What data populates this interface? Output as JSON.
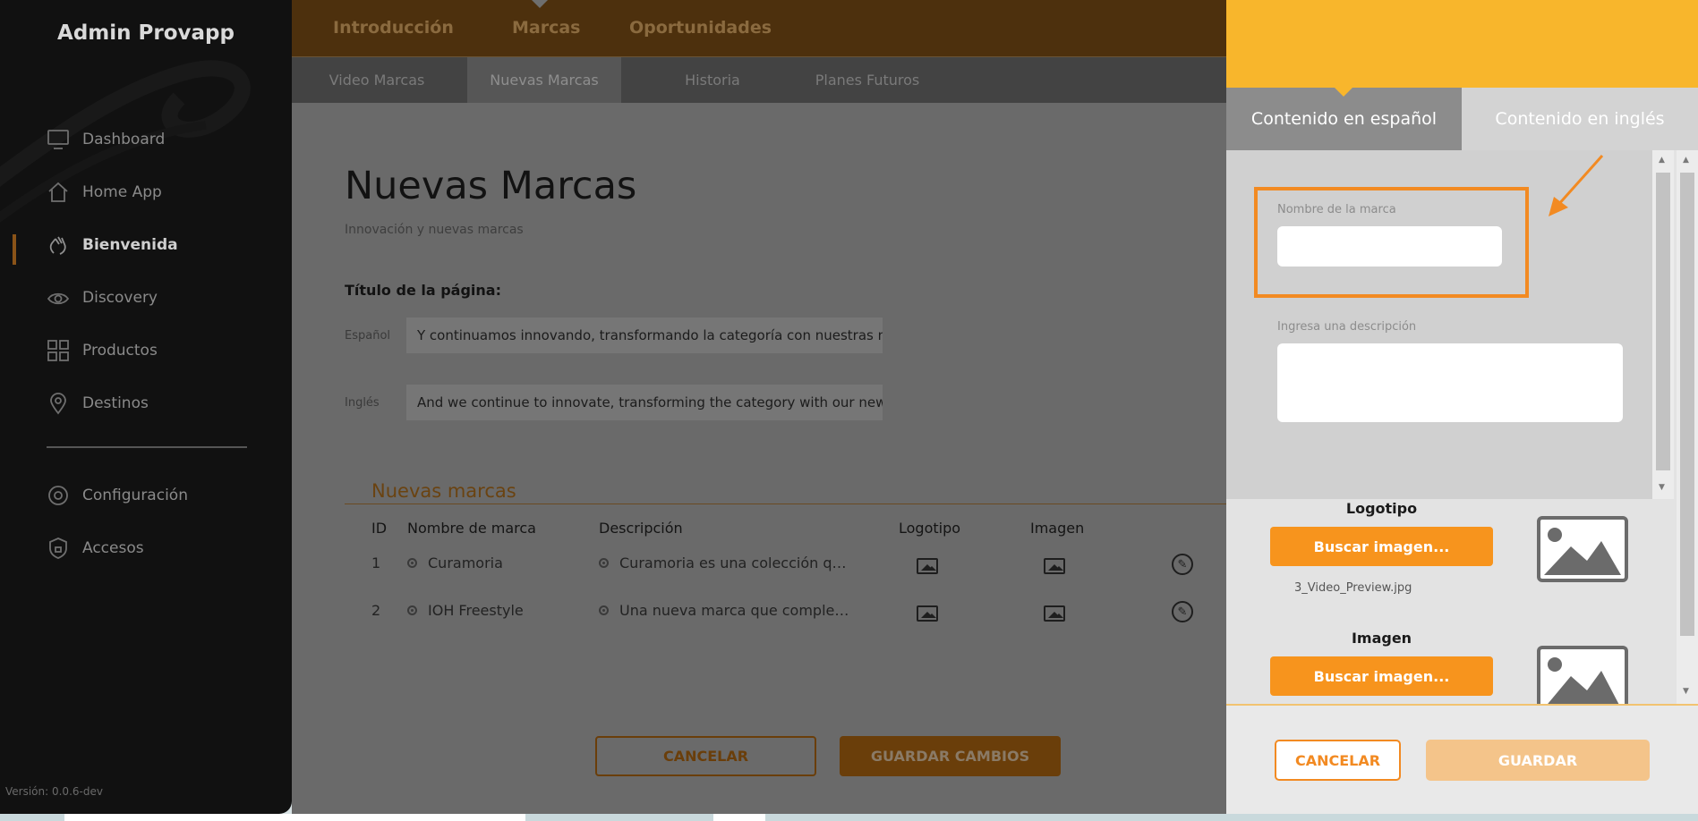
{
  "sidebar": {
    "brand": "Admin Provapp",
    "items": [
      {
        "label": "Dashboard",
        "icon": "monitor-icon"
      },
      {
        "label": "Home App",
        "icon": "home-icon"
      },
      {
        "label": "Bienvenida",
        "icon": "wave-hand-icon",
        "active": true
      },
      {
        "label": "Discovery",
        "icon": "eye-icon"
      },
      {
        "label": "Productos",
        "icon": "grid-icon"
      },
      {
        "label": "Destinos",
        "icon": "map-pin-icon"
      },
      {
        "label": "Configuración",
        "icon": "gear-icon"
      },
      {
        "label": "Accesos",
        "icon": "shield-icon"
      }
    ],
    "version": "Versión: 0.0.6-dev"
  },
  "topnav": {
    "tabs": [
      "Introducción",
      "Marcas",
      "Oportunidades"
    ],
    "active": "Marcas"
  },
  "subnav": {
    "tabs": [
      "Video Marcas",
      "Nuevas Marcas",
      "Historia",
      "Planes Futuros"
    ],
    "active": "Nuevas Marcas"
  },
  "main": {
    "title": "Nuevas Marcas",
    "subtitle": "Innovación y nuevas marcas",
    "page_title_label": "Título de la página:",
    "spanish_label": "Español",
    "spanish_value": "Y continuamos innovando, transformando la categoría con nuestras n",
    "english_label": "Inglés",
    "english_value": "And we continue to innovate, transforming the category with our new",
    "list_title": "Nuevas marcas",
    "table": {
      "headers": [
        "ID",
        "Nombre de marca",
        "Descripción",
        "Logotipo",
        "Imagen"
      ],
      "rows": [
        {
          "id": "1",
          "name": "Curamoria",
          "description": "Curamoria es una colección q…"
        },
        {
          "id": "2",
          "name": "IOH Freestyle",
          "description": "Una nueva marca que comple…"
        }
      ]
    },
    "cancel_label": "CANCELAR",
    "save_label": "GUARDAR CAMBIOS"
  },
  "panel": {
    "tabs": [
      "Contenido en español",
      "Contenido en inglés"
    ],
    "active_tab": "Contenido en español",
    "name_label": "Nombre de la marca",
    "name_value": "",
    "description_label": "Ingresa una descripción",
    "description_value": "",
    "logo_heading": "Logotipo",
    "logo_button": "Buscar imagen...",
    "logo_file": "3_Video_Preview.jpg",
    "image_heading": "Imagen",
    "image_button": "Buscar imagen...",
    "cancel_label": "CANCELAR",
    "save_label": "GUARDAR"
  },
  "colors": {
    "accent": "#f8b62c",
    "button_orange": "#f7941d",
    "highlight": "#f28a22"
  }
}
